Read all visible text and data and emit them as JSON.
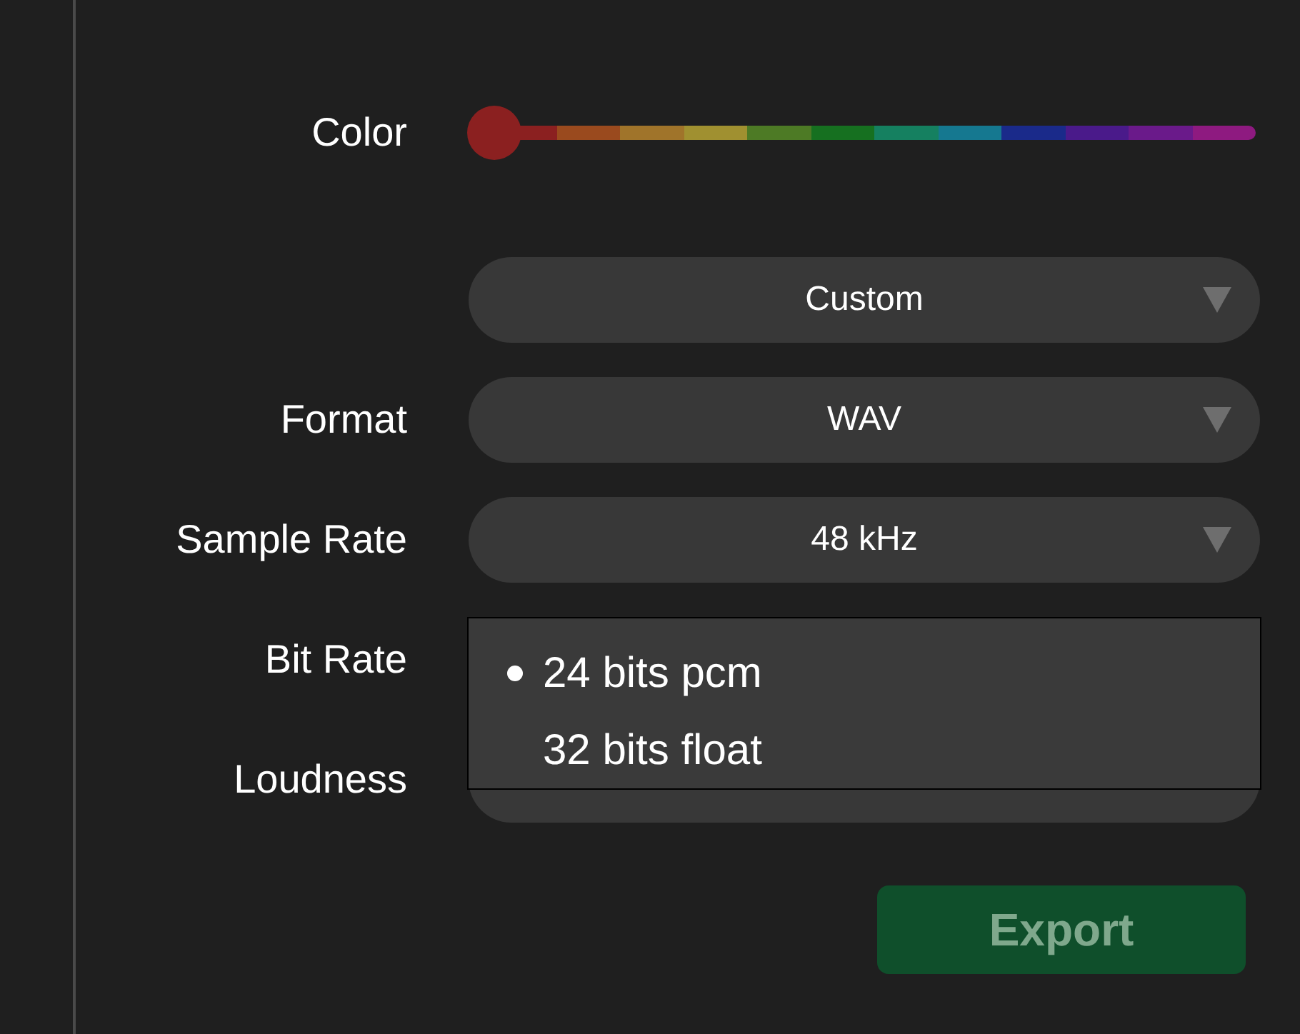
{
  "color": {
    "label": "Color",
    "level": 0
  },
  "fields": [
    {
      "value": "Custom"
    },
    {
      "label": "Format",
      "value": "WAV"
    },
    {
      "label": "Sample Rate",
      "value": "48 kHz"
    },
    {
      "label": "Bit Rate",
      "menu": [
        {
          "label": "24 bits pcm",
          "selected": true
        },
        {
          "label": "32 bits float",
          "selected": false
        }
      ]
    },
    {
      "label": "Loudness"
    }
  ],
  "export": {
    "label": "Export",
    "disabled": true
  }
}
